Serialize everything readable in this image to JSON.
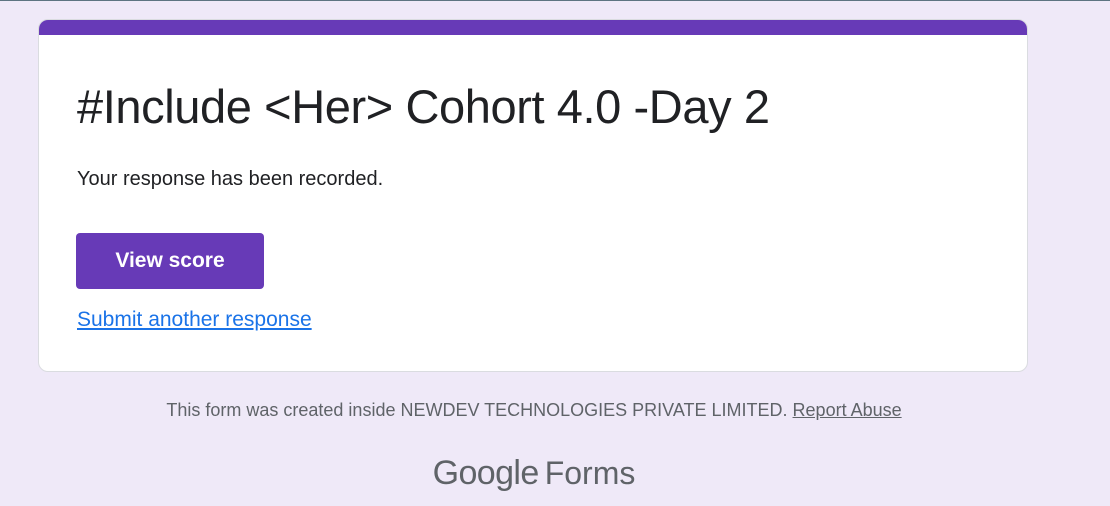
{
  "form": {
    "title": "#Include <Her> Cohort 4.0 -Day 2",
    "confirmation_message": "Your response has been recorded.",
    "view_score_label": "View score",
    "submit_another_label": "Submit another response"
  },
  "footer": {
    "created_inside_text": "This form was created inside NEWDEV TECHNOLOGIES PRIVATE LIMITED.",
    "report_abuse_label": "Report Abuse"
  },
  "brand": {
    "google": "Google",
    "forms": "Forms"
  },
  "colors": {
    "accent": "#673ab7",
    "page_background": "#efe9f8",
    "link": "#1a73e8"
  }
}
